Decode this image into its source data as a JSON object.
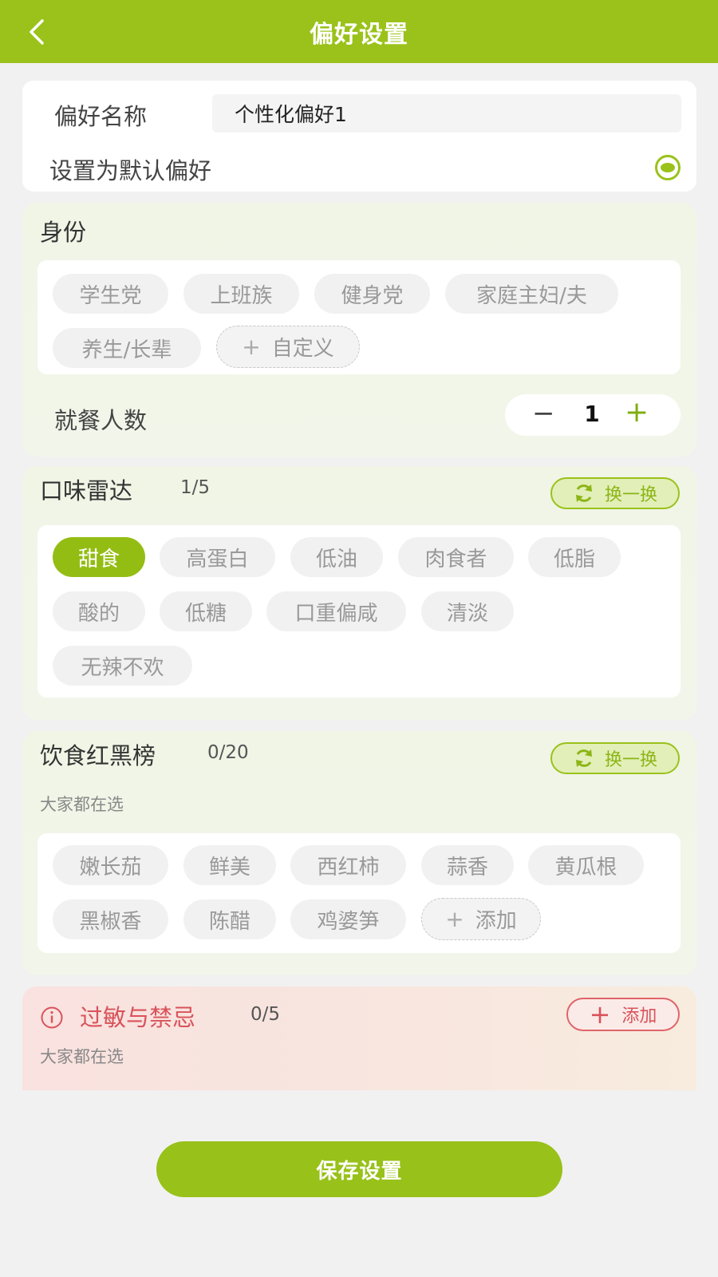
{
  "header": {
    "title": "偏好设置"
  },
  "basic": {
    "name_label": "偏好名称",
    "name_value": "个性化偏好1",
    "default_label": "设置为默认偏好",
    "default_checked": true
  },
  "identity": {
    "title": "身份",
    "tags": [
      "学生党",
      "上班族",
      "健身党",
      "家庭主妇/夫",
      "养生/长辈"
    ],
    "custom_label": "自定义",
    "diners_label": "就餐人数",
    "diners_value": "1"
  },
  "taste": {
    "title": "口味雷达",
    "count": "1/5",
    "swap_label": "换一换",
    "tags": [
      "甜食",
      "高蛋白",
      "低油",
      "肉食者",
      "低脂",
      "酸的",
      "低糖",
      "口重偏咸",
      "清淡",
      "无辣不欢"
    ],
    "selected": [
      "甜食"
    ]
  },
  "diet": {
    "title": "饮食红黑榜",
    "count": "0/20",
    "swap_label": "换一换",
    "subtitle": "大家都在选",
    "tags": [
      "嫩长茄",
      "鲜美",
      "西红柿",
      "蒜香",
      "黄瓜根",
      "黑椒香",
      "陈醋",
      "鸡婆笋"
    ],
    "add_label": "添加"
  },
  "allergy": {
    "title": "过敏与禁忌",
    "count": "0/5",
    "add_label": "添加",
    "subtitle": "大家都在选"
  },
  "footer": {
    "save_label": "保存设置"
  },
  "colors": {
    "primary": "#9ac21a",
    "danger": "#d9535b"
  }
}
